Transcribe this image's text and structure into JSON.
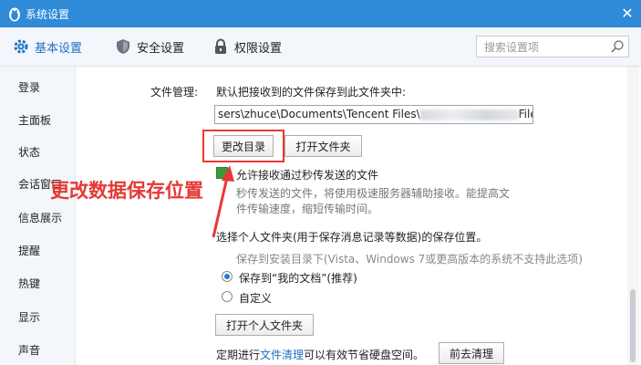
{
  "window": {
    "title": "系统设置",
    "close_glyph": "✕"
  },
  "topnav": {
    "tabs": [
      {
        "label": "基本设置",
        "icon": "gear-icon",
        "active": true
      },
      {
        "label": "安全设置",
        "icon": "shield-icon",
        "active": false
      },
      {
        "label": "权限设置",
        "icon": "lock-icon",
        "active": false
      }
    ],
    "search_placeholder": "搜索设置项"
  },
  "sidebar": {
    "items": [
      "登录",
      "主面板",
      "状态",
      "会话窗口",
      "信息展示",
      "提醒",
      "热键",
      "显示",
      "声音"
    ]
  },
  "file_mgmt": {
    "label": "文件管理:",
    "default_desc": "默认把接收到的文件保存到此文件夹中:",
    "path_prefix": "sers\\zhuce\\Documents\\Tencent Files\\",
    "path_suffix": "FileRecv\\",
    "change_dir_button": "更改目录",
    "open_folder_button": "打开文件夹",
    "allow_label": "允许接收通过秒传发送的文件",
    "allow_desc": "秒传发送的文件，将使用极速服务器辅助接收。能提高文件传输速度，缩短传输时间。",
    "choose_label": "选择个人文件夹(用于保存消息记录等数据)的保存位置。",
    "save_note": "保存到安装目录下(Vista、Windows 7或更高版本的系统不支持此选项)",
    "radio_docs": "保存到“我的文档”(推荐)",
    "radio_custom": "自定义",
    "open_personal_button": "打开个人文件夹",
    "periodic_prefix": "定期进行",
    "periodic_link": "文件清理",
    "periodic_suffix": "可以有效节省硬盘空间。",
    "clean_button": "前去清理"
  },
  "annotation": {
    "text": "更改数据保存位置",
    "color": "#e53935"
  },
  "colors": {
    "titlebar": "#2f8ad8",
    "accent": "#1f73c9",
    "checkbox": "#3a9b3a"
  }
}
